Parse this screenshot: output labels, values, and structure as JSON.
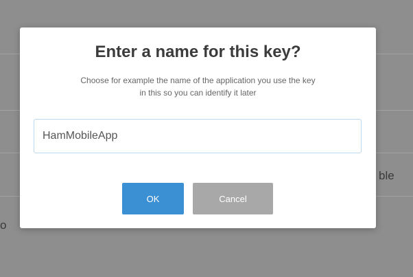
{
  "background": {
    "partial_text_right": "ble",
    "partial_text_left": "o"
  },
  "dialog": {
    "title": "Enter a name for this key?",
    "subtitle_line1": "Choose for example the name of the application you use the key",
    "subtitle_line2": "in this so you can identify it later",
    "key_name_value": "HamMobileApp",
    "ok_label": "OK",
    "cancel_label": "Cancel"
  },
  "colors": {
    "ok_button": "#3b8fd3",
    "cancel_button": "#a8a8a8",
    "overlay": "#8e8e8e"
  }
}
